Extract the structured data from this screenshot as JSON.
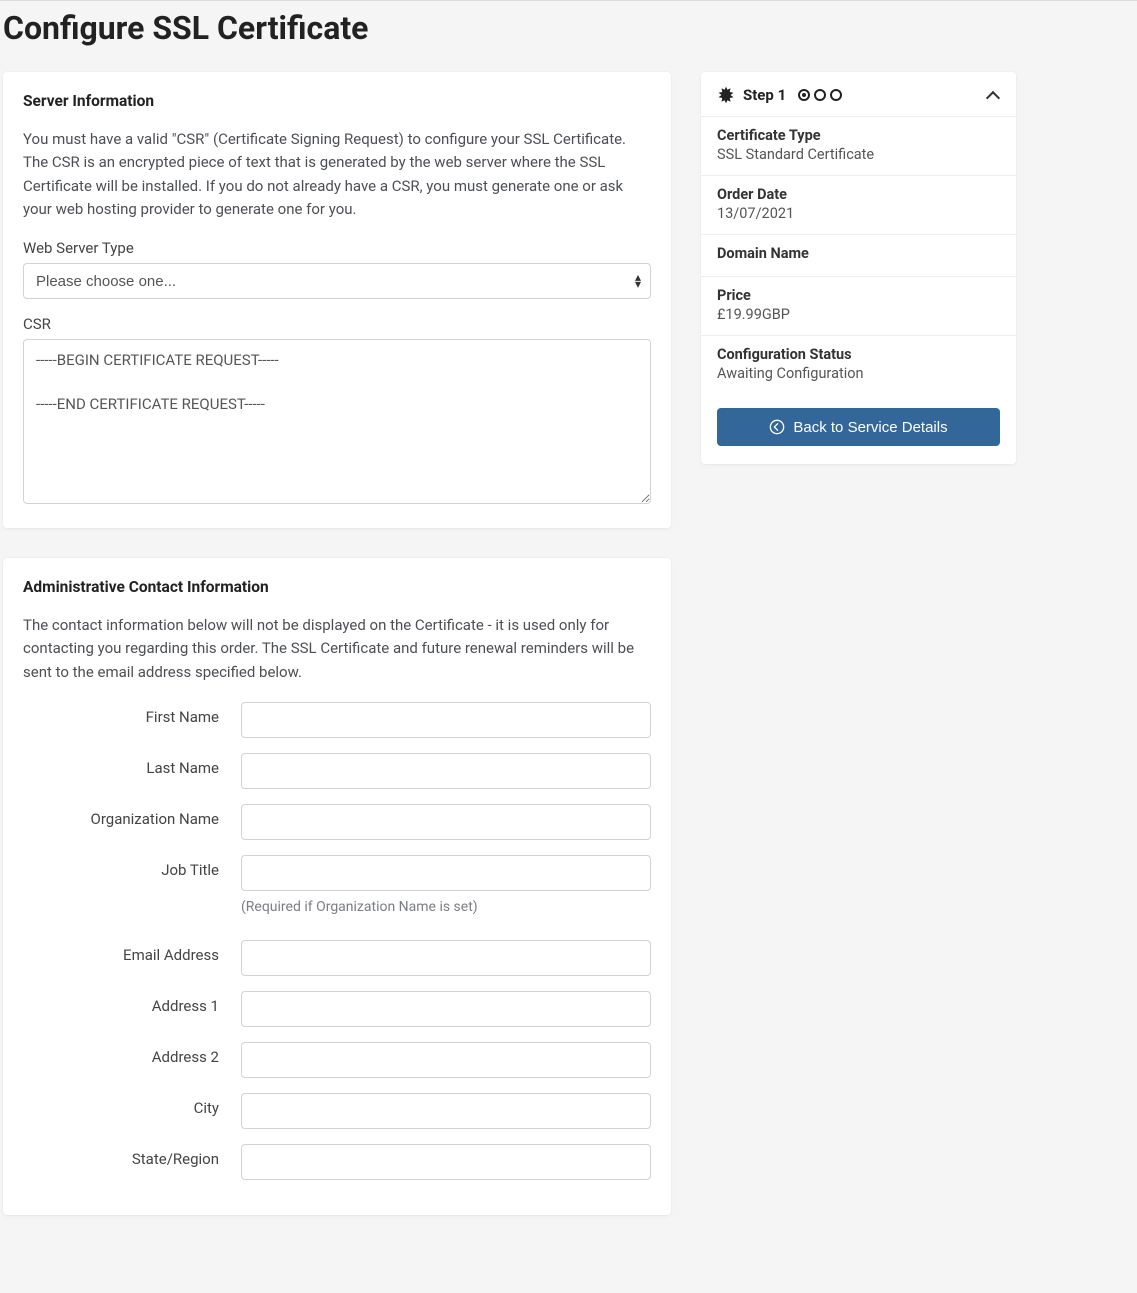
{
  "page": {
    "title": "Configure SSL Certificate"
  },
  "server_info": {
    "heading": "Server Information",
    "description": "You must have a valid \"CSR\" (Certificate Signing Request) to configure your SSL Certificate. The CSR is an encrypted piece of text that is generated by the web server where the SSL Certificate will be installed. If you do not already have a CSR, you must generate one or ask your web hosting provider to generate one for you.",
    "server_type_label": "Web Server Type",
    "server_type_placeholder": "Please choose one...",
    "csr_label": "CSR",
    "csr_value": "-----BEGIN CERTIFICATE REQUEST-----\n\n-----END CERTIFICATE REQUEST-----"
  },
  "admin": {
    "heading": "Administrative Contact Information",
    "description": "The contact information below will not be displayed on the Certificate - it is used only for contacting you regarding this order. The SSL Certificate and future renewal reminders will be sent to the email address specified below.",
    "fields": {
      "first_name": "First Name",
      "last_name": "Last Name",
      "org_name": "Organization Name",
      "job_title": "Job Title",
      "job_title_help": "(Required if Organization Name is set)",
      "email": "Email Address",
      "address1": "Address 1",
      "address2": "Address 2",
      "city": "City",
      "state": "State/Region"
    }
  },
  "sidebar": {
    "step_label": "Step 1",
    "items": [
      {
        "k": "Certificate Type",
        "v": "SSL Standard Certificate"
      },
      {
        "k": "Order Date",
        "v": "13/07/2021"
      },
      {
        "k": "Domain Name",
        "v": ""
      },
      {
        "k": "Price",
        "v": "£19.99GBP"
      },
      {
        "k": "Configuration Status",
        "v": "Awaiting Configuration"
      }
    ],
    "back_label": "Back to Service Details"
  }
}
